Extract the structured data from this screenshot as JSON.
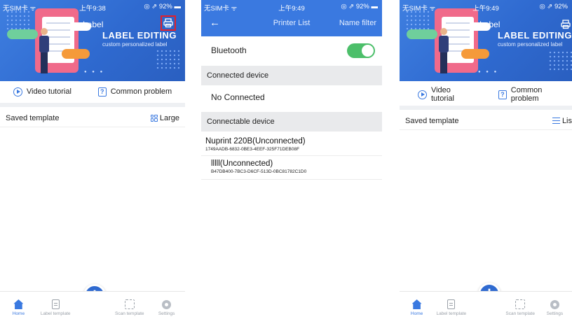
{
  "screens": {
    "home": {
      "status": {
        "carrier": "无SIM卡 ᯤ",
        "time": "上午9:38",
        "battery": "◎ ⇗ 92% ▬"
      },
      "banner": {
        "logo_text": "Label",
        "title": "LABEL EDITING",
        "subtitle": "custom personalized label",
        "pager": "● ● ●"
      },
      "links": {
        "video": "Video tutorial",
        "problem": "Common problem"
      },
      "saved": {
        "label": "Saved template",
        "view": "Large"
      }
    },
    "printer_list": {
      "status": {
        "carrier": "无SIM卡 ᯤ",
        "time": "上午9:49",
        "battery": "◎ ⇗ 92% ▬"
      },
      "nav": {
        "back": "←",
        "title": "Printer List",
        "filter": "Name filter"
      },
      "bluetooth": {
        "label": "Bluetooth",
        "enabled": true,
        "color": "#4cbf6a"
      },
      "connected_header": "Connected device",
      "no_connected": "No Connected",
      "connectable_header": "Connectable device",
      "devices": [
        {
          "name": "Nuprint 220B(Unconnected)",
          "id": "1749AADB-6832-0BE3-4EEF-325F71DEB08F"
        },
        {
          "name": "lllll(Unconnected)",
          "id": "B47DB400-7BC3-D6CF-513D-0BC81782C1D0"
        }
      ]
    },
    "home_list": {
      "status": {
        "carrier": "无SIM卡 ᯤ",
        "time": "上午9:49",
        "battery": "◎ ⇗ 92%"
      },
      "banner": {
        "logo_text": "Label",
        "title": "LABEL EDITING",
        "subtitle": "custom personalized label",
        "pager": "● ● ●"
      },
      "links": {
        "video": "Video tutorial",
        "problem": "Common problem"
      },
      "saved": {
        "label": "Saved template",
        "view": "Lis"
      }
    }
  },
  "tabbar": {
    "home": "Home",
    "label_template": "Label template",
    "scan_template": "Scan template",
    "settings": "Settings",
    "fab": "+"
  },
  "colors": {
    "accent": "#3a79e0",
    "banner": "#2f6ad0",
    "highlight": "#e3212b"
  }
}
